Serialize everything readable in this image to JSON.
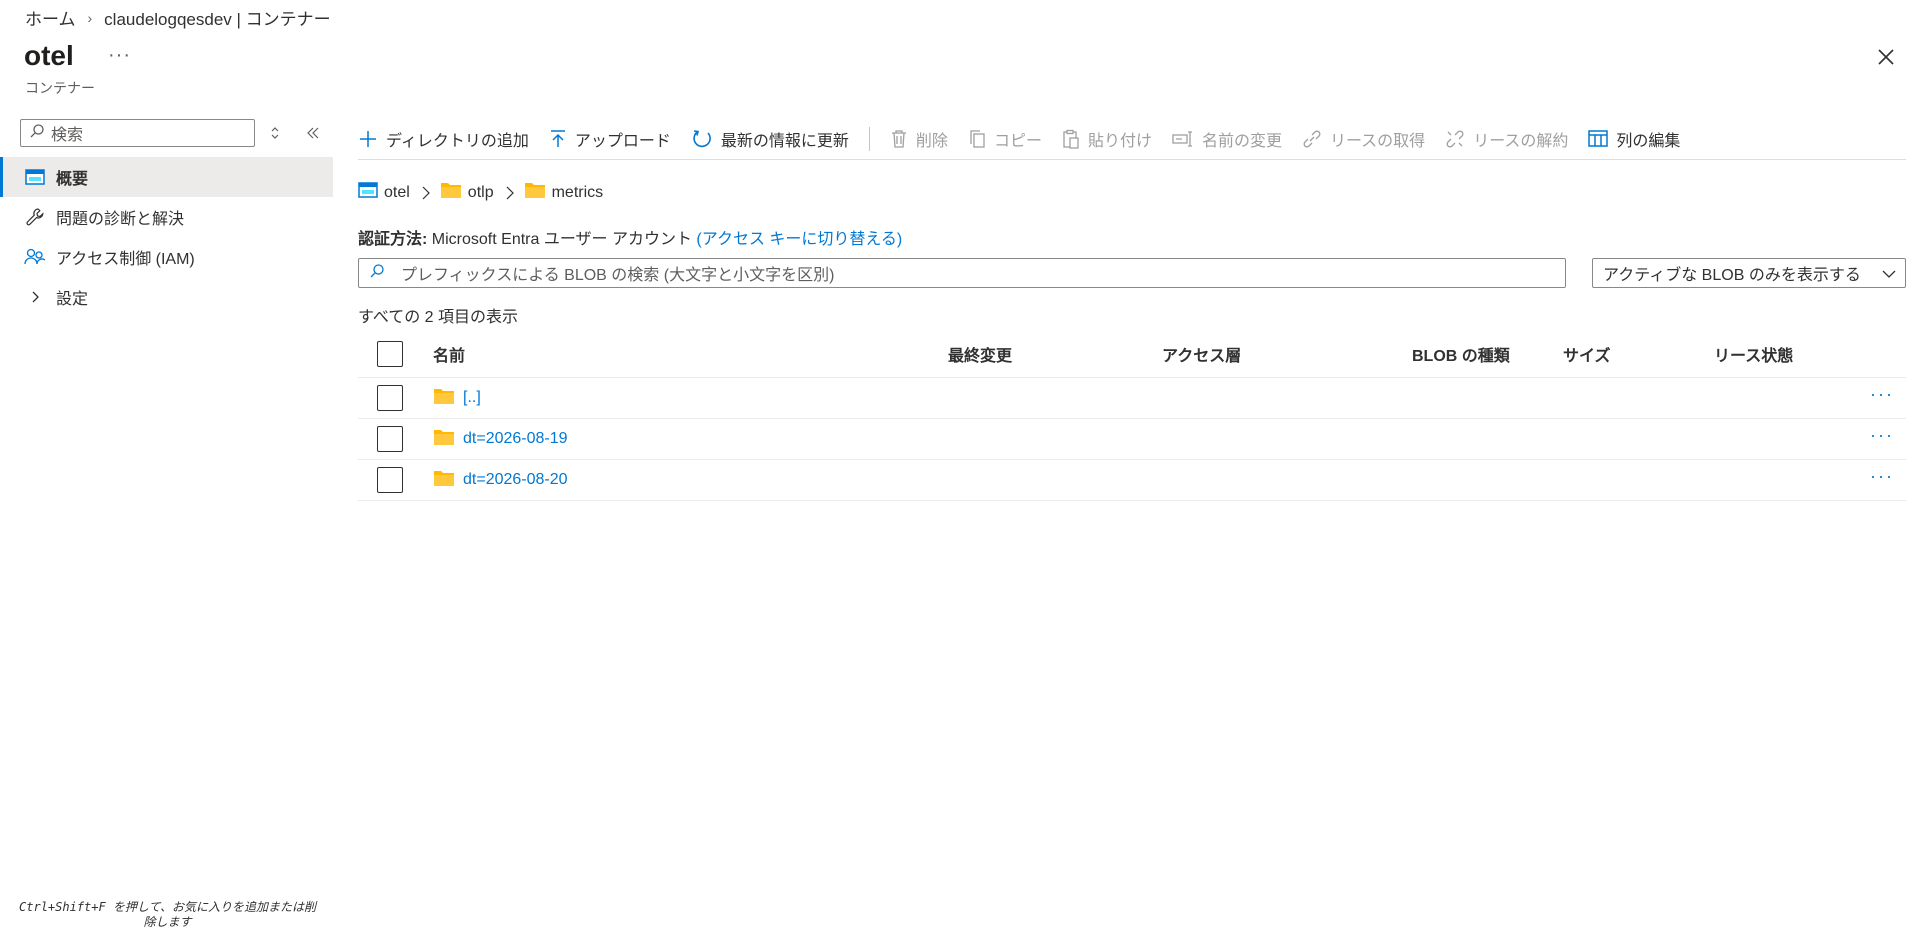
{
  "breadcrumb": {
    "home": "ホーム",
    "account": "claudelogqesdev | コンテナー"
  },
  "header": {
    "title": "otel",
    "more": "···",
    "subtitle": "コンテナー"
  },
  "sidebar": {
    "search_placeholder": "検索",
    "items": [
      {
        "label": "概要",
        "icon": "container-icon",
        "active": true
      },
      {
        "label": "問題の診断と解決",
        "icon": "wrench-icon"
      },
      {
        "label": "アクセス制御 (IAM)",
        "icon": "people-icon"
      },
      {
        "label": "設定",
        "icon": "chevron-right-icon"
      }
    ],
    "hint": "Ctrl+Shift+F を押して、お気に入りを追加または削除します"
  },
  "toolbar": {
    "add_directory": "ディレクトリの追加",
    "upload": "アップロード",
    "refresh": "最新の情報に更新",
    "delete": "削除",
    "copy": "コピー",
    "paste": "貼り付け",
    "rename": "名前の変更",
    "acquire_lease": "リースの取得",
    "break_lease": "リースの解約",
    "edit_columns": "列の編集"
  },
  "path": {
    "container": "otel",
    "folder1": "otlp",
    "folder2": "metrics"
  },
  "auth": {
    "label": "認証方法:",
    "value": "Microsoft Entra ユーザー アカウント",
    "link": "(アクセス キーに切り替える)"
  },
  "blob_search": {
    "placeholder": "プレフィックスによる BLOB の検索 (大文字と小文字を区別)"
  },
  "filter": {
    "selected": "アクティブな BLOB のみを表示する"
  },
  "count_text": "すべての 2 項目の表示",
  "table": {
    "columns": {
      "name": "名前",
      "modified": "最終変更",
      "tier": "アクセス層",
      "blob_type": "BLOB の種類",
      "size": "サイズ",
      "lease": "リース状態"
    },
    "rows": [
      {
        "name": "[..]",
        "more": "···"
      },
      {
        "name": "dt=2026-08-19",
        "more": "···"
      },
      {
        "name": "dt=2026-08-20",
        "more": "···"
      }
    ]
  },
  "colors": {
    "accent": "#0078d4",
    "folder": "#ffb900"
  }
}
